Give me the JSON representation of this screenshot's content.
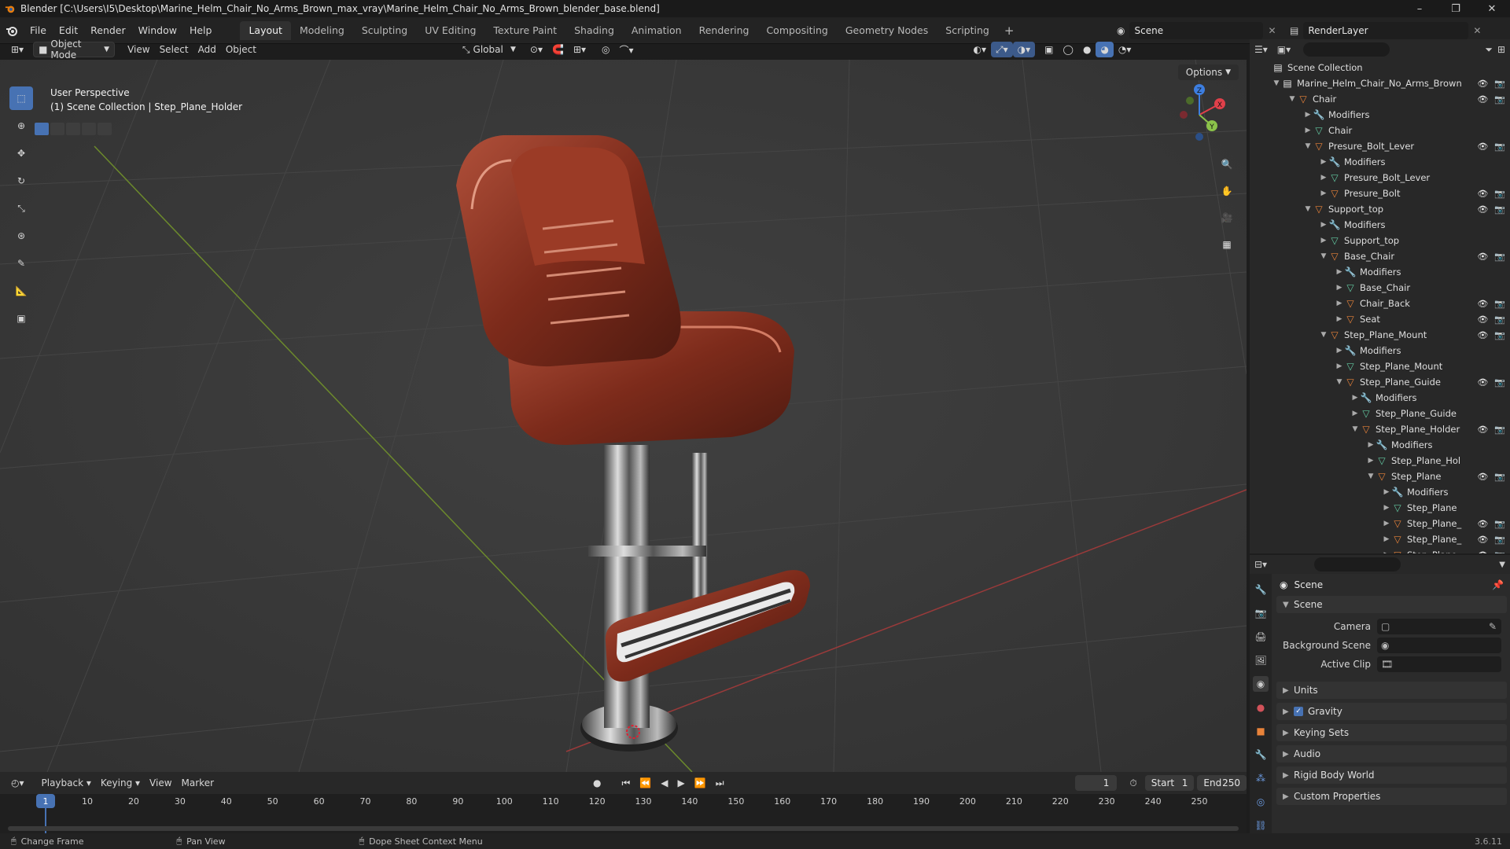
{
  "window": {
    "title": "Blender [C:\\Users\\I5\\Desktop\\Marine_Helm_Chair_No_Arms_Brown_max_vray\\Marine_Helm_Chair_No_Arms_Brown_blender_base.blend]",
    "minimize": "–",
    "maximize": "❐",
    "close": "✕"
  },
  "menu": [
    "File",
    "Edit",
    "Render",
    "Window",
    "Help"
  ],
  "workspaces": [
    "Layout",
    "Modeling",
    "Sculpting",
    "UV Editing",
    "Texture Paint",
    "Shading",
    "Animation",
    "Rendering",
    "Compositing",
    "Geometry Nodes",
    "Scripting"
  ],
  "workspace_add": "+",
  "scene_selector": "Scene",
  "renderlayer_selector": "RenderLayer",
  "viewport_header": {
    "mode": "Object Mode",
    "menus": [
      "View",
      "Select",
      "Add",
      "Object"
    ],
    "transform_orientation": "Global",
    "options": "Options"
  },
  "viewport": {
    "perspective": "User Perspective",
    "context": "(1) Scene Collection | Step_Plane_Holder",
    "gizmo_axes": [
      "X",
      "Y",
      "Z"
    ]
  },
  "toolbar_tools": [
    "select-box-icon",
    "cursor-icon",
    "move-icon",
    "rotate-icon",
    "scale-icon",
    "transform-icon",
    "annotate-icon",
    "measure-icon",
    "add-cube-icon"
  ],
  "outliner": {
    "root": "Scene Collection",
    "items": [
      {
        "label": "Marine_Helm_Chair_No_Arms_Brown",
        "depth": 0,
        "type": "coll",
        "open": true,
        "vis": true
      },
      {
        "label": "Chair",
        "depth": 1,
        "type": "obj",
        "open": true,
        "vis": true
      },
      {
        "label": "Modifiers",
        "depth": 2,
        "type": "mod",
        "open": false,
        "vis": false
      },
      {
        "label": "Chair",
        "depth": 2,
        "type": "mesh",
        "open": false,
        "vis": false
      },
      {
        "label": "Presure_Bolt_Lever",
        "depth": 2,
        "type": "obj",
        "open": true,
        "vis": true
      },
      {
        "label": "Modifiers",
        "depth": 3,
        "type": "mod",
        "open": false,
        "vis": false
      },
      {
        "label": "Presure_Bolt_Lever",
        "depth": 3,
        "type": "mesh",
        "open": false,
        "vis": false
      },
      {
        "label": "Presure_Bolt",
        "depth": 3,
        "type": "obj",
        "open": false,
        "vis": true
      },
      {
        "label": "Support_top",
        "depth": 2,
        "type": "obj",
        "open": true,
        "vis": true
      },
      {
        "label": "Modifiers",
        "depth": 3,
        "type": "mod",
        "open": false,
        "vis": false
      },
      {
        "label": "Support_top",
        "depth": 3,
        "type": "mesh",
        "open": false,
        "vis": false
      },
      {
        "label": "Base_Chair",
        "depth": 3,
        "type": "obj",
        "open": true,
        "vis": true
      },
      {
        "label": "Modifiers",
        "depth": 4,
        "type": "mod",
        "open": false,
        "vis": false
      },
      {
        "label": "Base_Chair",
        "depth": 4,
        "type": "mesh",
        "open": false,
        "vis": false
      },
      {
        "label": "Chair_Back",
        "depth": 4,
        "type": "obj",
        "open": false,
        "vis": true
      },
      {
        "label": "Seat",
        "depth": 4,
        "type": "obj",
        "open": false,
        "vis": true
      },
      {
        "label": "Step_Plane_Mount",
        "depth": 3,
        "type": "obj",
        "open": true,
        "vis": true
      },
      {
        "label": "Modifiers",
        "depth": 4,
        "type": "mod",
        "open": false,
        "vis": false
      },
      {
        "label": "Step_Plane_Mount",
        "depth": 4,
        "type": "mesh",
        "open": false,
        "vis": false
      },
      {
        "label": "Step_Plane_Guide",
        "depth": 4,
        "type": "obj",
        "open": true,
        "vis": true
      },
      {
        "label": "Modifiers",
        "depth": 5,
        "type": "mod",
        "open": false,
        "vis": false
      },
      {
        "label": "Step_Plane_Guide",
        "depth": 5,
        "type": "mesh",
        "open": false,
        "vis": false
      },
      {
        "label": "Step_Plane_Holder",
        "depth": 5,
        "type": "obj",
        "open": true,
        "vis": true
      },
      {
        "label": "Modifiers",
        "depth": 6,
        "type": "mod",
        "open": false,
        "vis": false
      },
      {
        "label": "Step_Plane_Hol",
        "depth": 6,
        "type": "mesh",
        "open": false,
        "vis": false
      },
      {
        "label": "Step_Plane",
        "depth": 6,
        "type": "obj",
        "open": true,
        "vis": true
      },
      {
        "label": "Modifiers",
        "depth": 7,
        "type": "mod",
        "open": false,
        "vis": false
      },
      {
        "label": "Step_Plane",
        "depth": 7,
        "type": "mesh",
        "open": false,
        "vis": false
      },
      {
        "label": "Step_Plane_",
        "depth": 7,
        "type": "obj",
        "open": false,
        "vis": true
      },
      {
        "label": "Step_Plane_",
        "depth": 7,
        "type": "obj",
        "open": false,
        "vis": true
      },
      {
        "label": "Step_Plane",
        "depth": 7,
        "type": "obj",
        "open": false,
        "vis": true
      }
    ]
  },
  "properties": {
    "header": "Scene",
    "panel_scene": "Scene",
    "camera_label": "Camera",
    "background_label": "Background Scene",
    "active_clip_label": "Active Clip",
    "collapsed_panels": [
      "Units",
      "Gravity",
      "Keying Sets",
      "Audio",
      "Rigid Body World",
      "Custom Properties"
    ],
    "gravity_checked": true
  },
  "timeline": {
    "menus": [
      "Playback",
      "Keying",
      "View",
      "Marker"
    ],
    "current_frame": "1",
    "start_label": "Start",
    "start": "1",
    "end_label": "End",
    "end": "250",
    "ticks": [
      "1",
      "10",
      "20",
      "30",
      "40",
      "50",
      "60",
      "70",
      "80",
      "90",
      "100",
      "110",
      "120",
      "130",
      "140",
      "150",
      "160",
      "170",
      "180",
      "190",
      "200",
      "210",
      "220",
      "230",
      "240",
      "250"
    ]
  },
  "statusbar": {
    "hint1": "Change Frame",
    "hint2": "Pan View",
    "hint3": "Dope Sheet Context Menu",
    "version": "3.6.11"
  },
  "colors": {
    "accent": "#4772b3",
    "object_orange": "#e8833a",
    "mesh_green": "#63c9a2",
    "leather": "#8a2f1c",
    "x_axis": "#e0404a",
    "y_axis": "#8bc34a",
    "z_axis": "#3d7ee0"
  }
}
